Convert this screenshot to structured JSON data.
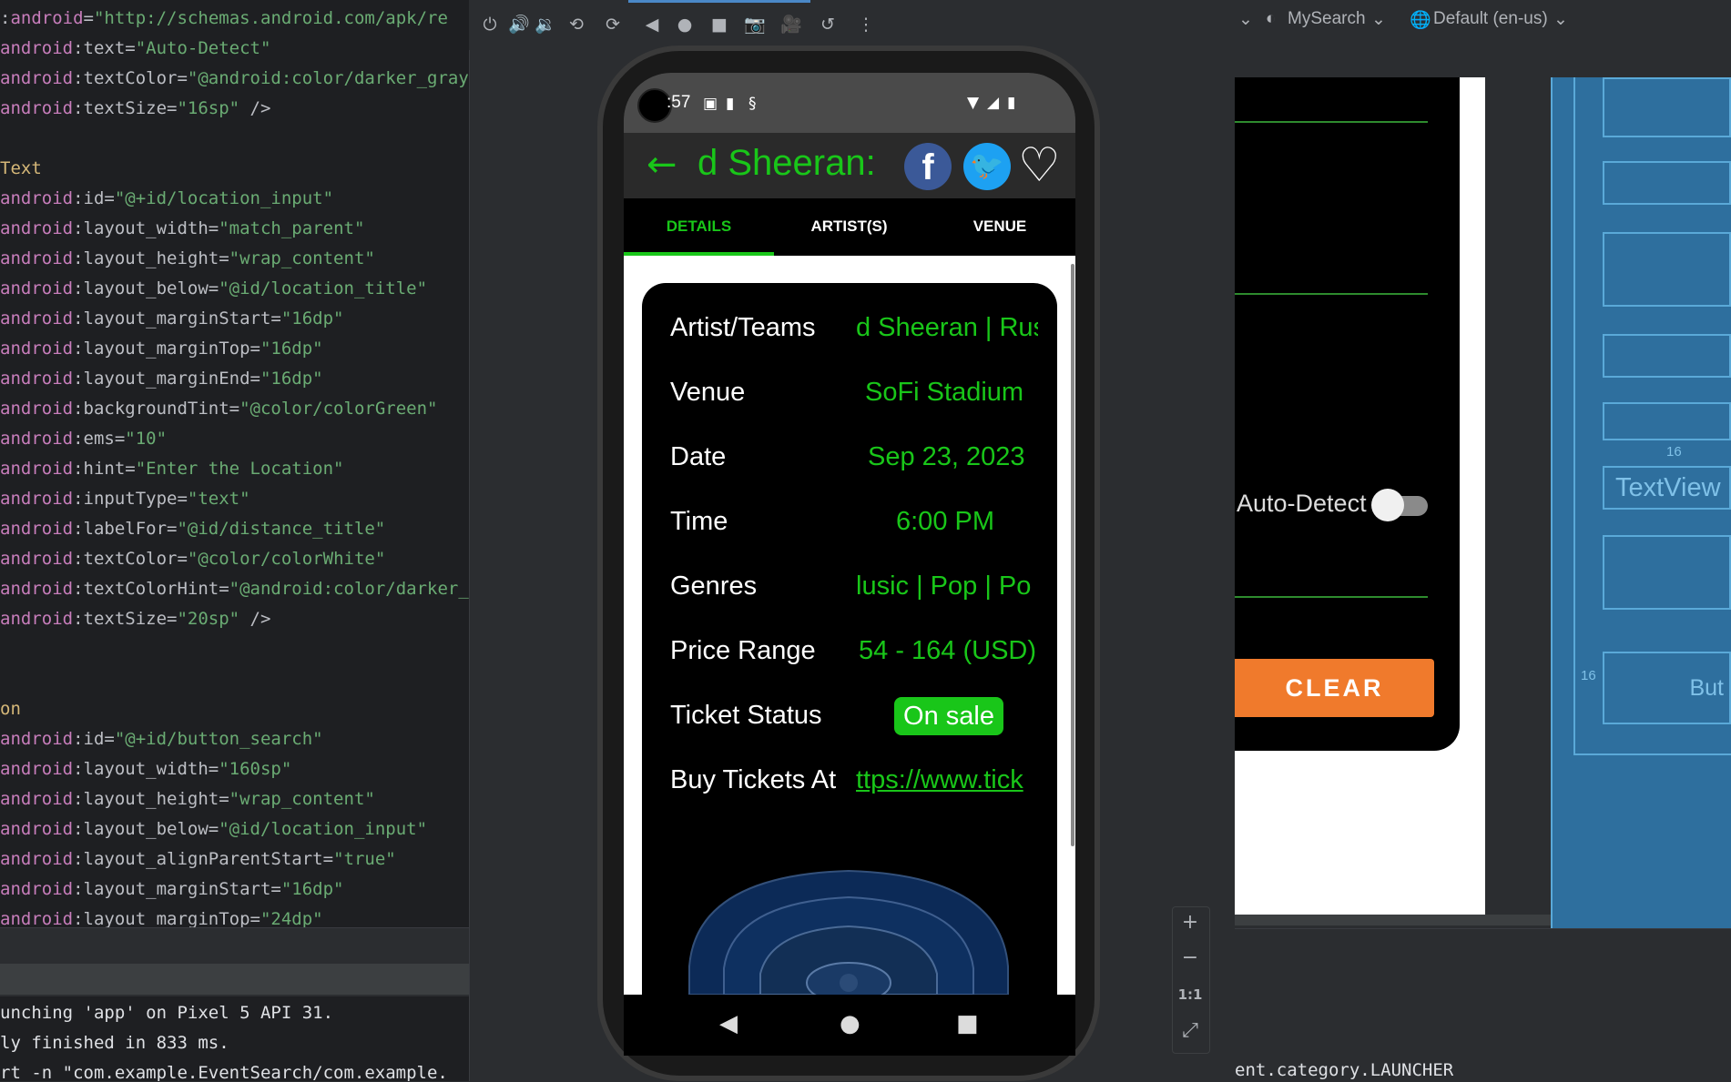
{
  "editor": {
    "lines": [
      {
        "prefix": ":",
        "ns": "android",
        "attr": "=",
        "value": "\"http://schemas.android.com/apk/re",
        "close": ""
      },
      {
        "prefix": "",
        "ns": "android",
        "attr": ":text=",
        "value": "\"Auto-Detect\"",
        "close": ""
      },
      {
        "prefix": "",
        "ns": "android",
        "attr": ":textColor=",
        "value": "\"@android:color/darker_gray",
        "close": ""
      },
      {
        "prefix": "",
        "ns": "android",
        "attr": ":textSize=",
        "value": "\"16sp\"",
        "close": " />"
      },
      {
        "prefix": "",
        "ns": "",
        "attr": "",
        "value": "",
        "close": ""
      },
      {
        "prefix": "",
        "ns": "",
        "attr": "",
        "value": "",
        "close": "",
        "tag": "Text"
      },
      {
        "prefix": "",
        "ns": "android",
        "attr": ":id=",
        "value": "\"@+id/location_input\"",
        "close": ""
      },
      {
        "prefix": "",
        "ns": "android",
        "attr": ":layout_width=",
        "value": "\"match_parent\"",
        "close": ""
      },
      {
        "prefix": "",
        "ns": "android",
        "attr": ":layout_height=",
        "value": "\"wrap_content\"",
        "close": ""
      },
      {
        "prefix": "",
        "ns": "android",
        "attr": ":layout_below=",
        "value": "\"@id/location_title\"",
        "close": ""
      },
      {
        "prefix": "",
        "ns": "android",
        "attr": ":layout_marginStart=",
        "value": "\"16dp\"",
        "close": ""
      },
      {
        "prefix": "",
        "ns": "android",
        "attr": ":layout_marginTop=",
        "value": "\"16dp\"",
        "close": ""
      },
      {
        "prefix": "",
        "ns": "android",
        "attr": ":layout_marginEnd=",
        "value": "\"16dp\"",
        "close": ""
      },
      {
        "prefix": "",
        "ns": "android",
        "attr": ":backgroundTint=",
        "value": "\"@color/colorGreen\"",
        "close": ""
      },
      {
        "prefix": "",
        "ns": "android",
        "attr": ":ems=",
        "value": "\"10\"",
        "close": ""
      },
      {
        "prefix": "",
        "ns": "android",
        "attr": ":hint=",
        "value": "\"Enter the Location\"",
        "close": ""
      },
      {
        "prefix": "",
        "ns": "android",
        "attr": ":inputType=",
        "value": "\"text\"",
        "close": ""
      },
      {
        "prefix": "",
        "ns": "android",
        "attr": ":labelFor=",
        "value": "\"@id/distance_title\"",
        "close": ""
      },
      {
        "prefix": "",
        "ns": "android",
        "attr": ":textColor=",
        "value": "\"@color/colorWhite\"",
        "close": ""
      },
      {
        "prefix": "",
        "ns": "android",
        "attr": ":textColorHint=",
        "value": "\"@android:color/darker_",
        "close": ""
      },
      {
        "prefix": "",
        "ns": "android",
        "attr": ":textSize=",
        "value": "\"20sp\"",
        "close": " />"
      },
      {
        "prefix": "",
        "ns": "",
        "attr": "",
        "value": "",
        "close": ""
      },
      {
        "prefix": "",
        "ns": "",
        "attr": "",
        "value": "",
        "close": ""
      },
      {
        "prefix": "",
        "ns": "",
        "attr": "",
        "value": "",
        "close": "",
        "tag": "on"
      },
      {
        "prefix": "",
        "ns": "android",
        "attr": ":id=",
        "value": "\"@+id/button_search\"",
        "close": ""
      },
      {
        "prefix": "",
        "ns": "android",
        "attr": ":layout_width=",
        "value": "\"160sp\"",
        "close": ""
      },
      {
        "prefix": "",
        "ns": "android",
        "attr": ":layout_height=",
        "value": "\"wrap_content\"",
        "close": ""
      },
      {
        "prefix": "",
        "ns": "android",
        "attr": ":layout_below=",
        "value": "\"@id/location_input\"",
        "close": ""
      },
      {
        "prefix": "",
        "ns": "android",
        "attr": ":layout_alignParentStart=",
        "value": "\"true\"",
        "close": ""
      },
      {
        "prefix": "",
        "ns": "android",
        "attr": ":layout_marginStart=",
        "value": "\"16dp\"",
        "close": ""
      },
      {
        "prefix": "",
        "ns": "android",
        "attr": ":layout_marginTop=",
        "value": "\"24dp\"",
        "close": ""
      }
    ]
  },
  "console": {
    "lines": [
      "unching 'app' on Pixel 5 API 31.",
      "ly finished in 833 ms.",
      "rt -n \"com.example.EventSearch/com.example."
    ],
    "right_tail": "ent.category.LAUNCHER"
  },
  "emulator_toolbar": {
    "icons": [
      "power-icon",
      "volume-up-icon",
      "volume-down-icon",
      "rotate-left-icon",
      "rotate-right-icon",
      "back-icon",
      "home-icon",
      "overview-icon",
      "screenshot-icon",
      "record-icon",
      "reset-icon",
      "more-icon"
    ],
    "glyphs": [
      "⏻",
      "🔊",
      "🔉",
      "⟲",
      "⟳",
      "◀",
      "●",
      "■",
      "📷",
      "🎥",
      "↺",
      "⋮"
    ]
  },
  "status_bar": {
    "clock": ":57"
  },
  "app": {
    "title": "d Sheeran:",
    "facebook_glyph": "f",
    "twitter_glyph": "🐦",
    "heart_glyph": "♡",
    "tabs": [
      "DETAILS",
      "ARTIST(S)",
      "VENUE"
    ],
    "details": [
      {
        "label": "Artist/Teams",
        "value": "d Sheeran | Rus"
      },
      {
        "label": "Venue",
        "value": "SoFi Stadium"
      },
      {
        "label": "Date",
        "value": "Sep 23, 2023"
      },
      {
        "label": "Time",
        "value": "6:00 PM"
      },
      {
        "label": "Genres",
        "value": "lusic | Pop | Po"
      },
      {
        "label": "Price Range",
        "value": "54 - 164 (USD)"
      },
      {
        "label": "Ticket Status",
        "value": "On sale"
      },
      {
        "label": "Buy Tickets At",
        "value": "ttps://www.tick"
      }
    ],
    "colors": {
      "accent": "#19c619",
      "appbar": "#2a2a2a",
      "background": "#000000"
    }
  },
  "zoom_controls": {
    "zoom_in": "+",
    "zoom_out": "−",
    "actual_size": "1:1",
    "fit": "⤢"
  },
  "design": {
    "toolbar": {
      "theme": "MySearch",
      "locale": "Default (en-us)"
    },
    "auto_detect_label": "Auto-Detect",
    "clear_button": "CLEAR",
    "blueprint": {
      "textview": "TextView",
      "button": "But",
      "margin_top": "16",
      "margin_start": "16"
    }
  }
}
